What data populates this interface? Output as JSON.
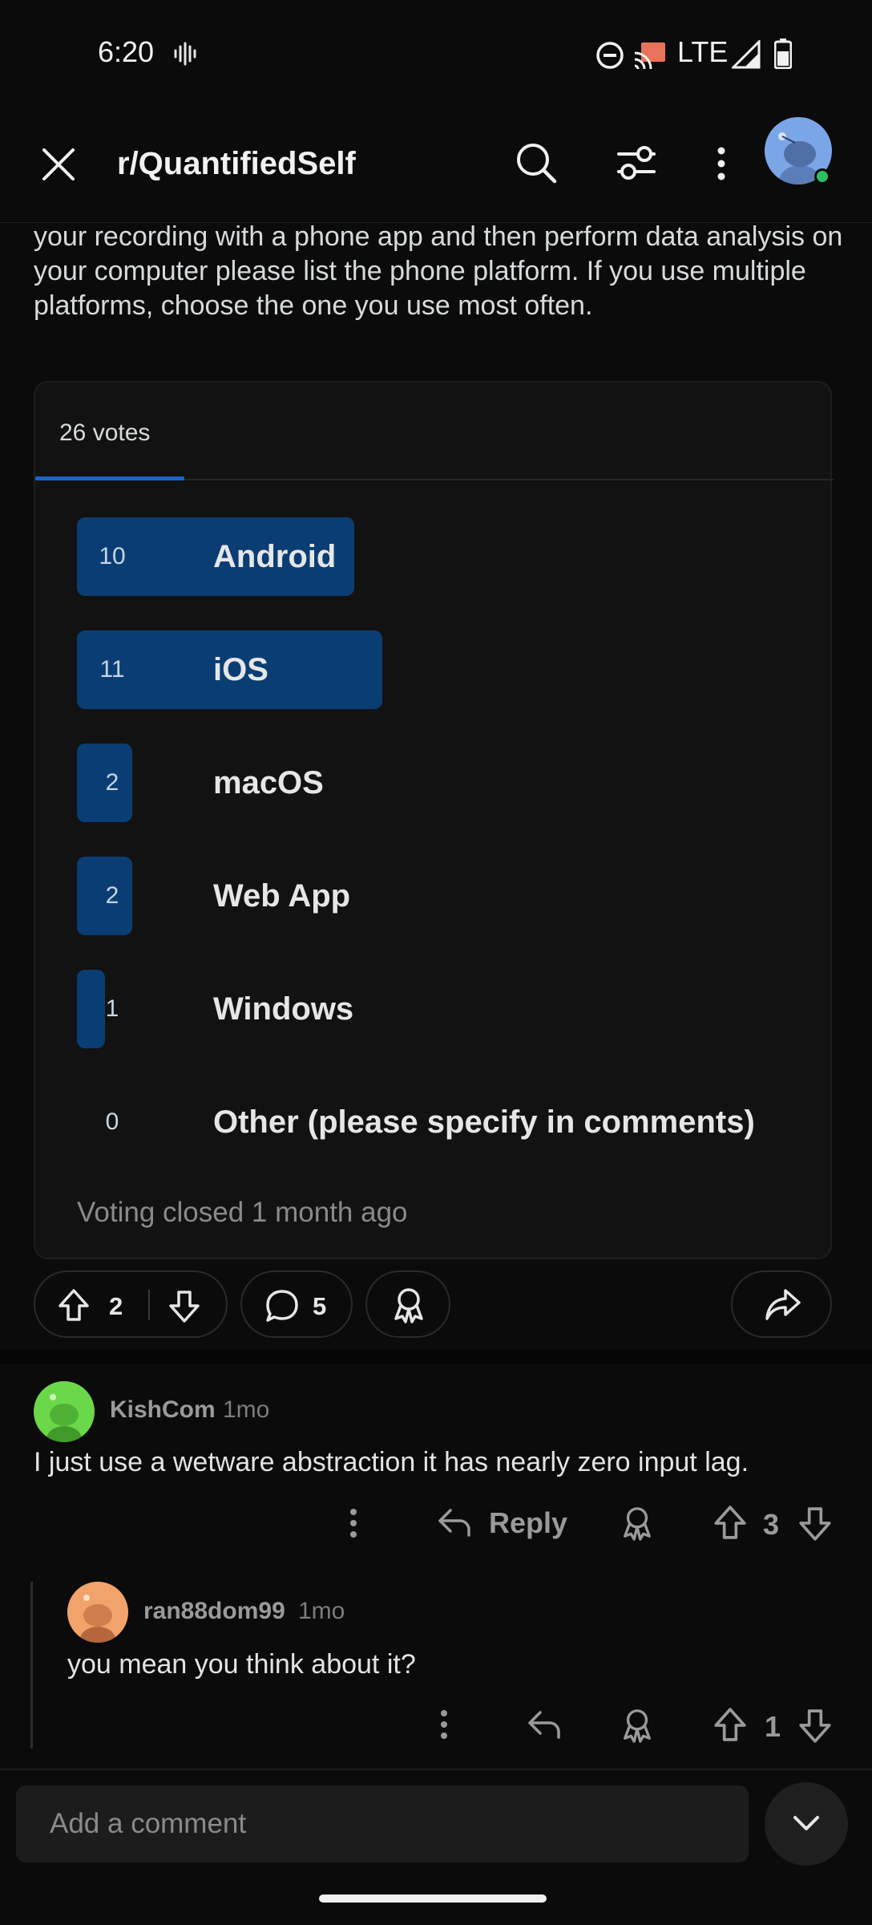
{
  "status_bar": {
    "time": "6:20",
    "network": "LTE"
  },
  "header": {
    "title": "r/QuantifiedSelf"
  },
  "post": {
    "text": "your recording with a phone app and then perform data analysis on your computer please list the phone platform. If you use multiple platforms, choose the one you use most often."
  },
  "poll": {
    "votes_label": "26 votes",
    "options": [
      {
        "count": "10",
        "label": "Android",
        "fraction": 0.3846
      },
      {
        "count": "11",
        "label": "iOS",
        "fraction": 0.4231
      },
      {
        "count": "2",
        "label": "macOS",
        "fraction": 0.0769
      },
      {
        "count": "2",
        "label": "Web App",
        "fraction": 0.0769
      },
      {
        "count": "1",
        "label": "Windows",
        "fraction": 0.0385
      },
      {
        "count": "0",
        "label": "Other (please specify in comments)",
        "fraction": 0
      }
    ],
    "closed_text": "Voting closed 1 month ago"
  },
  "actions": {
    "score": "2",
    "comments": "5"
  },
  "comments": [
    {
      "user": "KishCom",
      "time": "1mo",
      "body": "I just use a wetware abstraction it has nearly zero input lag.",
      "reply_label": "Reply",
      "score": "3",
      "avatar_color": "#6bd84a"
    },
    {
      "user": "ran88dom99",
      "time": "1mo",
      "body": "you mean you think about it?",
      "score": "1",
      "avatar_color": "#f2a36b"
    }
  ],
  "composer": {
    "placeholder": "Add a comment"
  },
  "colors": {
    "poll_bar": "#0a3d73",
    "accent": "#1a63c9",
    "online": "#2dbe60"
  }
}
